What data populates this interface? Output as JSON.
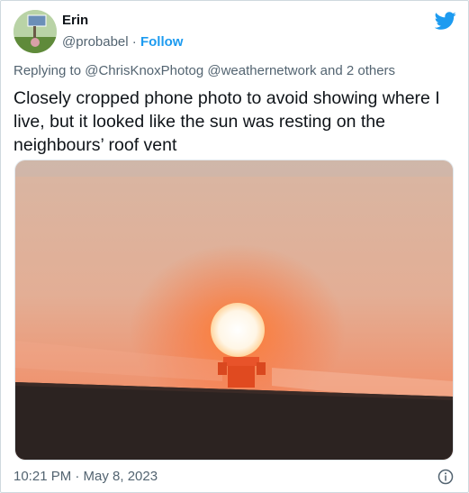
{
  "author": {
    "display_name": "Erin",
    "handle": "@probabel",
    "separator": "·",
    "follow_label": "Follow"
  },
  "reply": {
    "prefix": "Replying to",
    "mention_1": "@ChrisKnoxPhotog",
    "mention_2": "@weathernetwork",
    "others": "and 2 others"
  },
  "tweet": {
    "text": "Closely cropped phone photo to avoid showing where I live, but it looked like the sun was resting on the neighbours’ roof vent"
  },
  "footer": {
    "timestamp": "10:21 PM · May 8, 2023"
  },
  "icons": {
    "brand": "twitter-bird-icon",
    "info": "info-icon"
  },
  "colors": {
    "accent": "#1d9bf0",
    "muted_text": "#536471",
    "main_text": "#0f1419",
    "border": "#cfd9de"
  }
}
